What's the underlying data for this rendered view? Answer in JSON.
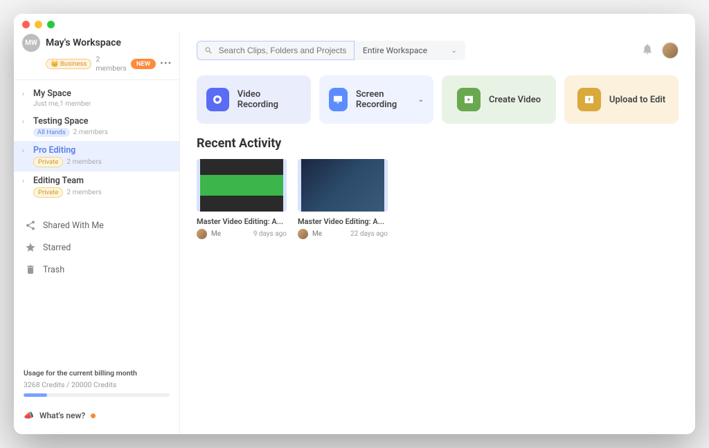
{
  "workspace": {
    "avatar_initials": "MW",
    "title": "May's Workspace",
    "plan_badge": "Business",
    "members": "2 members",
    "new_badge": "NEW"
  },
  "spaces": [
    {
      "name": "My Space",
      "sub": "Just me,1 member",
      "badge": null
    },
    {
      "name": "Testing Space",
      "sub": "2 members",
      "badge": "All Hands",
      "badge_class": "allhands"
    },
    {
      "name": "Pro Editing",
      "sub": "2 members",
      "badge": "Private",
      "badge_class": "private",
      "active": true
    },
    {
      "name": "Editing Team",
      "sub": "2 members",
      "badge": "Private",
      "badge_class": "private"
    }
  ],
  "nav": {
    "shared": "Shared With Me",
    "starred": "Starred",
    "trash": "Trash"
  },
  "usage": {
    "title": "Usage for the current billing month",
    "text": "3268 Credits / 20000 Credits",
    "fill_pct": 16
  },
  "whatsnew": "What's new?",
  "search": {
    "placeholder": "Search Clips, Folders and Projects",
    "scope": "Entire Workspace"
  },
  "notification_badge": "",
  "actions": {
    "video_recording": "Video Recording",
    "screen_recording": "Screen Recording",
    "create_video": "Create Video",
    "upload": "Upload to Edit"
  },
  "recent_heading": "Recent Activity",
  "clips": [
    {
      "title": "Master Video Editing: A...",
      "author": "Me",
      "ago": "9 days ago"
    },
    {
      "title": "Master Video Editing: A...",
      "author": "Me",
      "ago": "22 days ago"
    }
  ]
}
